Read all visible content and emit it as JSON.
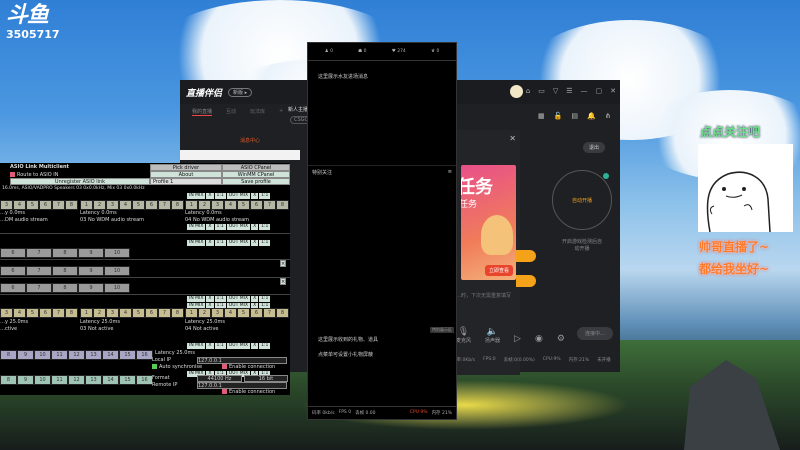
{
  "stream": {
    "logo": "斗鱼",
    "room_id": "3505717"
  },
  "zhibo": {
    "brand": "直播伴侣",
    "version_pill": "新版 ▸",
    "tabs": [
      "我的直播",
      "互动",
      "玩法库"
    ],
    "add_tab": "+",
    "room_title": "新人主播",
    "category": "CSGO",
    "message_center": "消息中心",
    "window_icons": [
      "⌂",
      "▭",
      "▽",
      "☰",
      "—",
      "▢",
      "✕"
    ],
    "tool_icons": [
      "▦",
      "🔓",
      "▤",
      "🔔",
      "⋔"
    ],
    "exit": "退出",
    "dialog_close": "✕",
    "banner": {
      "big": "任务",
      "small": "任务",
      "cta": "立即查看"
    },
    "auto_start": "自动开播",
    "auto_hint": "开启游戏检测后自动开播",
    "tip": "…时，下次无需重复填写",
    "controls": [
      {
        "icon": "🎙",
        "label": "麦克风"
      },
      {
        "icon": "🔈",
        "label": "扬声器"
      },
      {
        "icon": "▷",
        "label": ""
      },
      {
        "icon": "◉",
        "label": ""
      },
      {
        "icon": "⚙",
        "label": ""
      }
    ],
    "connect": "连接中...",
    "status": [
      "码率:0Kb/s",
      "FPS:0",
      "丢帧:0(0.00%)",
      "CPU:9%",
      "内存:21%",
      "未开播"
    ]
  },
  "chat": {
    "stats": [
      {
        "icon": "♟",
        "value": "0"
      },
      {
        "icon": "☗",
        "value": "0"
      },
      {
        "icon": "♥",
        "value": "274"
      },
      {
        "icon": "♛",
        "value": "0"
      }
    ],
    "enter_msg": "这里展示水友进场消息",
    "special_follow": "特别关注",
    "menu_icon": "≡",
    "special_area": "特别展示区",
    "gift_msg1": "这里展示收到的礼物、道具",
    "gift_msg2": "点菜单可设置小礼物屏蔽",
    "footer": {
      "bitrate": "码率 0kb/s",
      "fps": "FPS 0",
      "drop": "丢帧 0.00",
      "cpu": "CPU 9%",
      "mem": "内存 21%"
    }
  },
  "asio": {
    "title": "ASIO Link Multiclient",
    "route": "Route to ASIO IN",
    "pick_driver": "Pick driver",
    "asio_cpanel": "ASIO CPanel",
    "about": "About",
    "winmm_cpanel": "WinMM CPanel",
    "unregister": "Unregister ASIO link",
    "profile": "Profile 1",
    "save_profile": "Save profile",
    "info": "16.0ms, ASIO/VADPRO Speakers 03 0x0.0kHz, Mix 03 0x0.0kHz",
    "mix": [
      "IN MIX",
      "X",
      "1:1",
      "OUT MIX",
      "X",
      "1:1"
    ],
    "latency0": "Latency 0.0ms",
    "latency25": "Latency 25.0ms",
    "stream_a": "…DM audio stream",
    "stream_b": "03 No WDM audio stream",
    "stream_c": "04 No WDM audio stream",
    "not_active_a": "…ctive",
    "not_active_b": "03 Not active",
    "not_active_c": "04 Not active",
    "ch_partial": [
      "3",
      "4",
      "5",
      "6",
      "7",
      "8"
    ],
    "ch_full": [
      "1",
      "2",
      "3",
      "4",
      "5",
      "6",
      "7",
      "8"
    ],
    "ch_6_10": [
      "6",
      "7",
      "8",
      "9",
      "10"
    ],
    "ch_8_16": [
      "8",
      "9",
      "10",
      "11",
      "12",
      "13",
      "14",
      "15",
      "16"
    ],
    "latency_left": "…y 0.0ms",
    "latency_left25": "…y 25.0ms",
    "local_ip_label": "Local IP",
    "local_ip": "127.0.0.1",
    "auto_sync": "Auto synchronise",
    "enable": "Enable connection",
    "format_label": "Format",
    "format": "44100 Hz",
    "bits": "16 bit",
    "remote_ip_label": "Remote IP",
    "remote_ip": "127.0.0.1",
    "close": "×"
  },
  "overlay": {
    "follow": "点点关注吧",
    "line1": "帅哥直播了~",
    "line2": "都给我坐好~"
  }
}
